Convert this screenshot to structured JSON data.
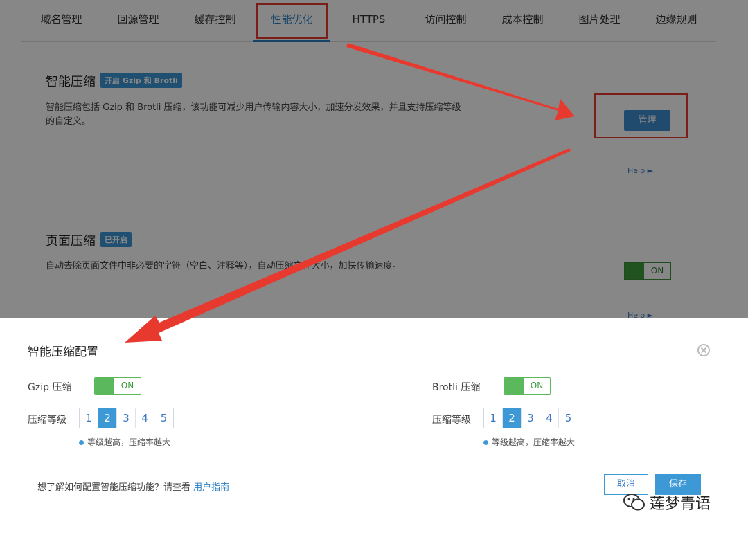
{
  "tabs": [
    {
      "label": "域名管理"
    },
    {
      "label": "回源管理"
    },
    {
      "label": "缓存控制"
    },
    {
      "label": "性能优化"
    },
    {
      "label": "HTTPS"
    },
    {
      "label": "访问控制"
    },
    {
      "label": "成本控制"
    },
    {
      "label": "图片处理"
    },
    {
      "label": "边缘规则"
    }
  ],
  "active_tab": "性能优化",
  "smart_compress": {
    "title": "智能压缩",
    "badge": "开启 Gzip 和 Brotli",
    "desc_line1": "智能压缩包括 Gzip 和 Brotli 压缩，该功能可减少用户传输内容大小，加速分发效果，并且支持压缩等级",
    "desc_line2": "的自定义。",
    "manage_label": "管理",
    "help_label": "Help ►"
  },
  "page_compress": {
    "title": "页面压缩",
    "badge": "已开启",
    "desc": "自动去除页面文件中非必要的字符（空白、注释等），自动压缩文件大小，加快传输速度。",
    "toggle_label": "ON",
    "help_label": "Help ►"
  },
  "modal": {
    "title": "智能压缩配置",
    "gzip_label": "Gzip 压缩",
    "gzip_toggle": "ON",
    "brotli_label": "Brotli 压缩",
    "brotli_toggle": "ON",
    "level_label": "压缩等级",
    "levels": [
      "1",
      "2",
      "3",
      "4",
      "5"
    ],
    "gzip_selected_level": "2",
    "brotli_selected_level": "2",
    "hint": "等级越高，压缩率越大",
    "footer_text": "想了解如何配置智能压缩功能？请查看",
    "footer_link": "用户指南",
    "cancel_label": "取消",
    "save_label": "保存"
  },
  "watermark": {
    "text": "莲梦青语"
  },
  "colors": {
    "accent": "#3d98d6",
    "toggle_on": "#5cb85c",
    "annotation_red": "#e8392f"
  }
}
